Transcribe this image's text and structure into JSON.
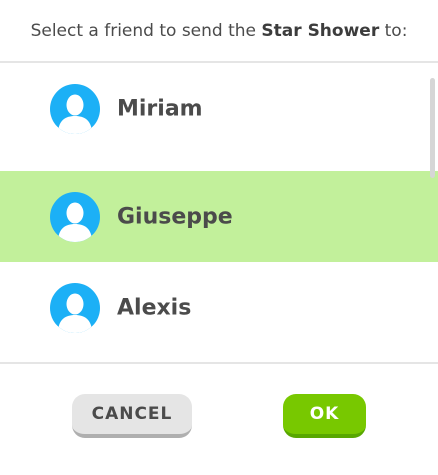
{
  "header": {
    "prefix": "Select a friend to send the",
    "item_name": "Star Shower",
    "suffix": "to:"
  },
  "friends": [
    {
      "name": "Miriam",
      "selected": false,
      "icon": "user-avatar-icon"
    },
    {
      "name": "Giuseppe",
      "selected": true,
      "icon": "user-avatar-icon"
    },
    {
      "name": "Alexis",
      "selected": false,
      "icon": "user-avatar-icon"
    }
  ],
  "buttons": {
    "cancel_label": "CANCEL",
    "ok_label": "OK"
  },
  "colors": {
    "selected_row": "#c2f09b",
    "avatar": "#1cb0f6",
    "ok_button": "#78c800",
    "cancel_button": "#e5e5e5"
  }
}
